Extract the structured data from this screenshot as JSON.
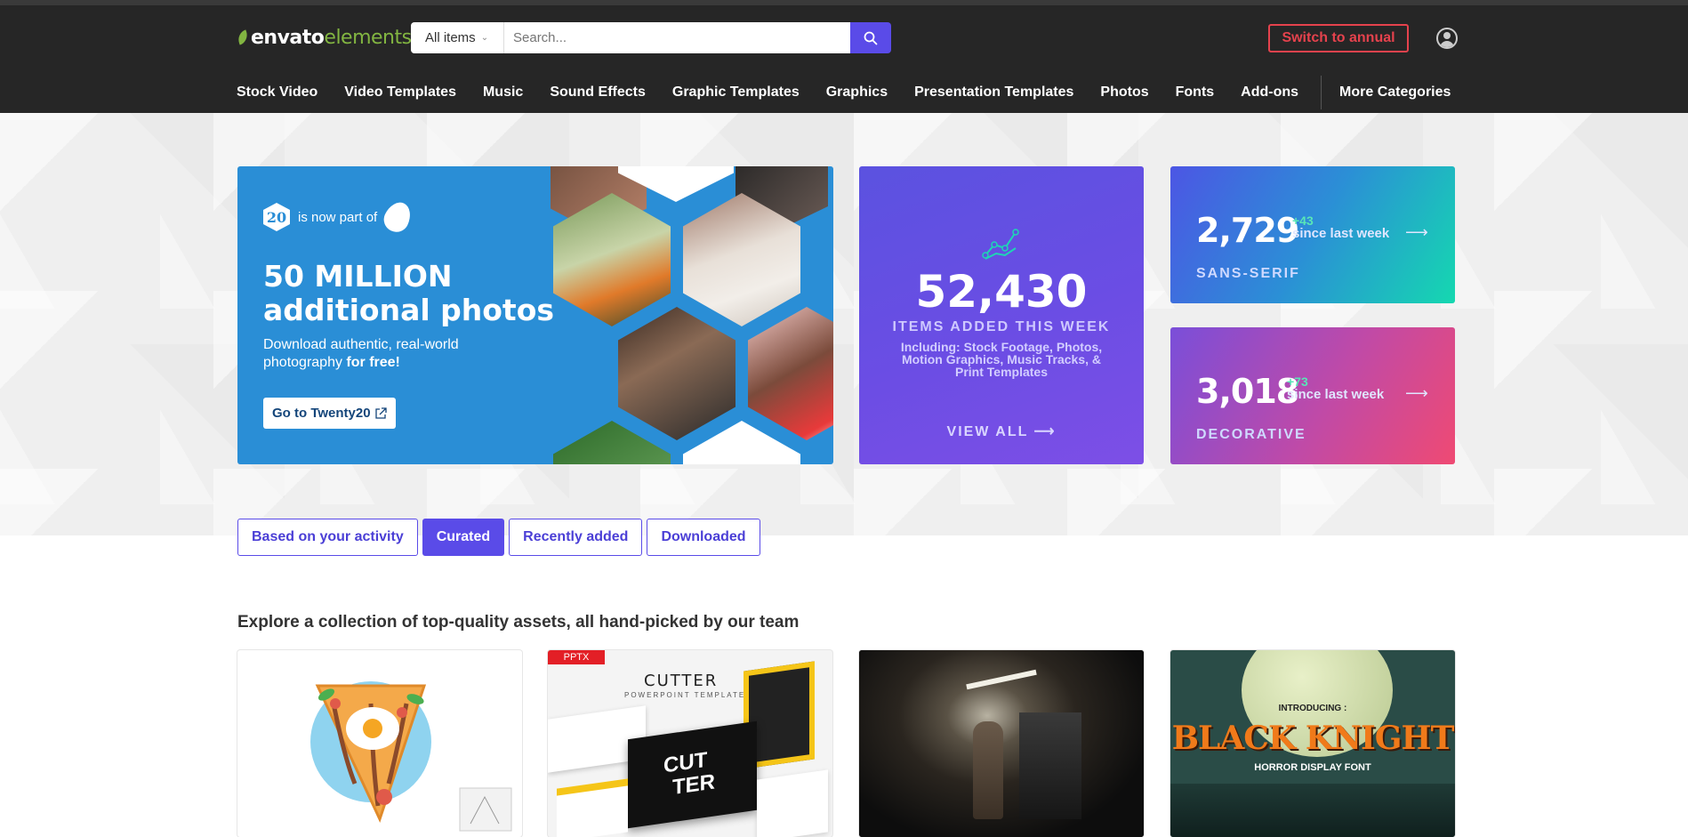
{
  "header": {
    "logo_bold": "envato",
    "logo_light": "elements",
    "search_select": "All items",
    "search_placeholder": "Search...",
    "switch_annual": "Switch to annual"
  },
  "nav": {
    "items": [
      "Stock Video",
      "Video Templates",
      "Music",
      "Sound Effects",
      "Graphic Templates",
      "Graphics",
      "Presentation Templates",
      "Photos",
      "Fonts",
      "Add-ons"
    ],
    "more": "More Categories"
  },
  "promo": {
    "badge": "20",
    "now_part_of": "is now part of",
    "heading": "50 MILLION additional photos",
    "desc_start": "Download authentic, real-world photography",
    "desc_bold": "for free!",
    "cta": "Go to Twenty20",
    "colors": {
      "bg": "#2a8ed6"
    }
  },
  "stats": {
    "count": "52,430",
    "label": "ITEMS ADDED THIS WEEK",
    "including": "Including: Stock Footage, Photos, Motion Graphics, Music Tracks, & Print Templates",
    "view_all": "VIEW ALL",
    "icon": "trend-chart-icon"
  },
  "mini_cards": [
    {
      "number": "2,729",
      "delta": "+43",
      "since": "since last week",
      "category": "SANS-SERIF"
    },
    {
      "number": "3,018",
      "delta": "+73",
      "since": "since last week",
      "category": "DECORATIVE"
    }
  ],
  "tabs": {
    "items": [
      "Based on your activity",
      "Curated",
      "Recently added",
      "Downloaded"
    ],
    "active": "Curated"
  },
  "section": {
    "heading": "Explore a collection of top-quality assets, all hand-picked by our team"
  },
  "cards": [
    {
      "kind": "illustration"
    },
    {
      "kind": "presentation",
      "badge": "PPTX",
      "title": "CUTTER",
      "subtitle": "POWERPOINT TEMPLATE",
      "cover_word_1": "CUT",
      "cover_word_2": "TER"
    },
    {
      "kind": "photo"
    },
    {
      "kind": "font",
      "intro": "INTRODUCING :",
      "title": "BLACK KNIGHT",
      "subtitle": "HORROR DISPLAY FONT"
    }
  ],
  "colors": {
    "accent": "#5a4be8",
    "header_bg": "#262626",
    "danger": "#e5424d",
    "envato_green": "#82b541"
  }
}
